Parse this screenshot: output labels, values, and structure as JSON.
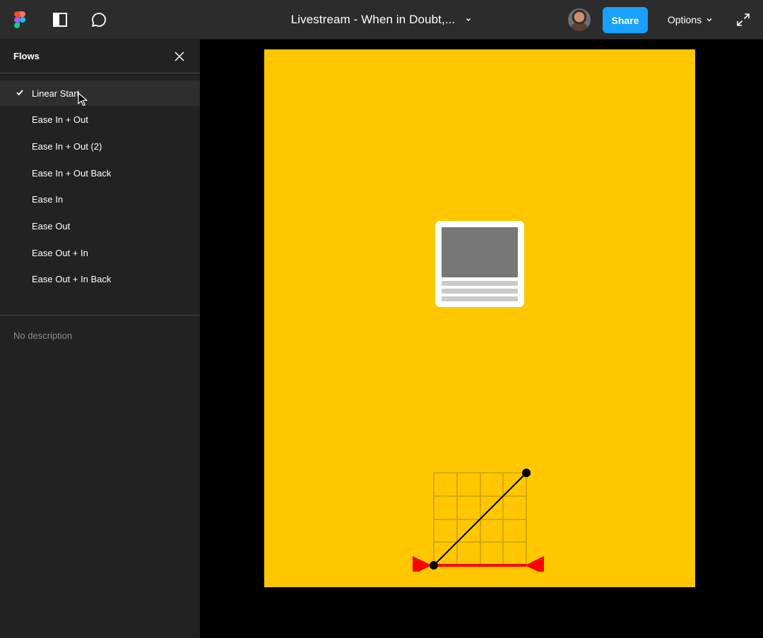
{
  "topbar": {
    "logo_icon": "figma-logo-icon",
    "sidebar_toggle_icon": "sidebar-panel-icon",
    "comments_icon": "comment-bubble-icon",
    "file_title": "Livestream - When in Doubt,...",
    "title_menu_icon": "chevron-down-icon",
    "avatar_icon": "user-avatar",
    "share_label": "Share",
    "options_label": "Options",
    "options_icon": "chevron-down-icon",
    "fullscreen_icon": "expand-icon"
  },
  "sidebar": {
    "title": "Flows",
    "close_icon": "close-icon",
    "selected_index": 0,
    "flows": [
      {
        "label": "Linear Start"
      },
      {
        "label": "Ease In + Out"
      },
      {
        "label": "Ease In + Out (2)"
      },
      {
        "label": "Ease In + Out Back"
      },
      {
        "label": "Ease In"
      },
      {
        "label": "Ease Out"
      },
      {
        "label": "Ease Out + In"
      },
      {
        "label": "Ease Out + In Back"
      }
    ],
    "description": "No description"
  },
  "canvas": {
    "background_color": "#000000",
    "frame_color": "#ffc700",
    "card_color": "#ffffff",
    "curve_line_color": "#000000",
    "curve_marker_color": "#ff0000"
  }
}
